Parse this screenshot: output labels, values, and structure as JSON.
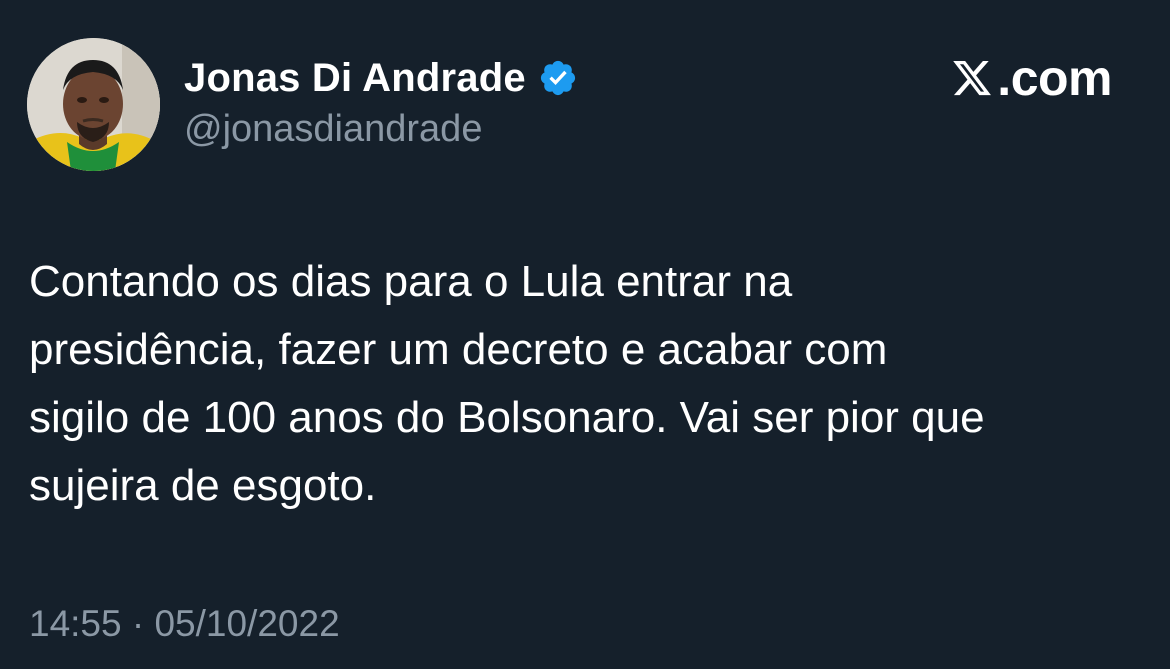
{
  "author": {
    "display_name": "Jonas Di Andrade",
    "handle": "@jonasdiandrade",
    "verified": true,
    "avatar_icon": "profile-photo"
  },
  "brand": {
    "label": "𝕏.com",
    "text": ".com",
    "icon": "x-logo-icon"
  },
  "tweet": {
    "text": "Contando os dias para o Lula entrar na\npresidência, fazer um decreto e acabar com\nsigilo de 100 anos do Bolsonaro. Vai ser pior que\nsujeira de esgoto.",
    "time": "14:55",
    "separator": "·",
    "date": "05/10/2022",
    "timestamp": "14:55 · 05/10/2022"
  },
  "colors": {
    "background": "#15202b",
    "primary_text": "#ffffff",
    "secondary_text": "#8b98a5",
    "verified_blue": "#1d9bf0"
  }
}
